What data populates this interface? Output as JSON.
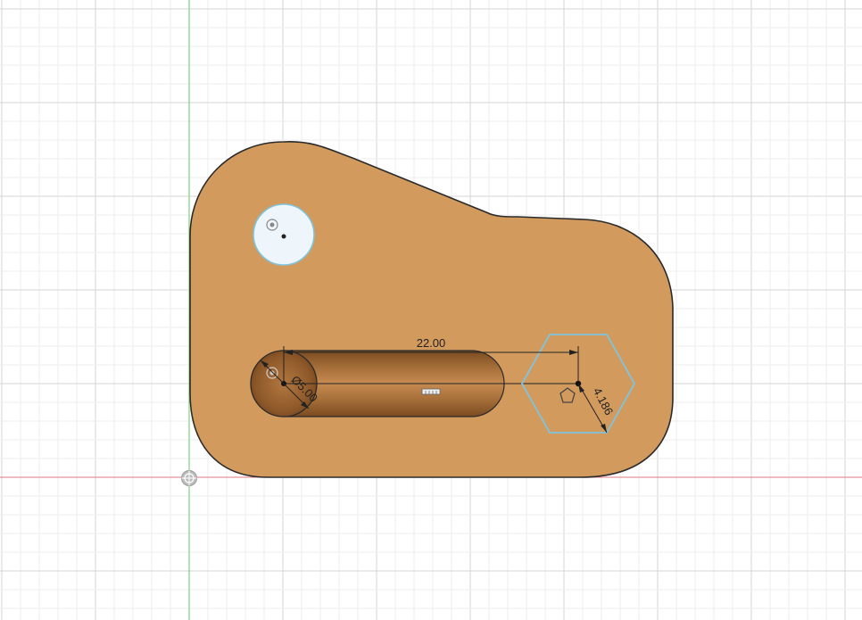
{
  "colors": {
    "background": "#ffffff",
    "grid_minor": "#eeeeee",
    "grid_major": "#d6d6d6",
    "axis_vertical": "#7ed07e",
    "axis_horizontal": "#e07a86",
    "part_fill": "#d39a5e",
    "part_outline": "#2a2a2a",
    "sketch_selection": "#7fc4dc"
  },
  "dimensions": {
    "slot_length": "22.00",
    "hole_diameter": "Ø5.00",
    "polygon_radius": "4.186"
  },
  "icons": {
    "origin": "origin-icon",
    "hole_point": "hole-point-icon",
    "slot_feature": "slot-feature-icon",
    "polygon_glyph": "pentagon-icon"
  }
}
